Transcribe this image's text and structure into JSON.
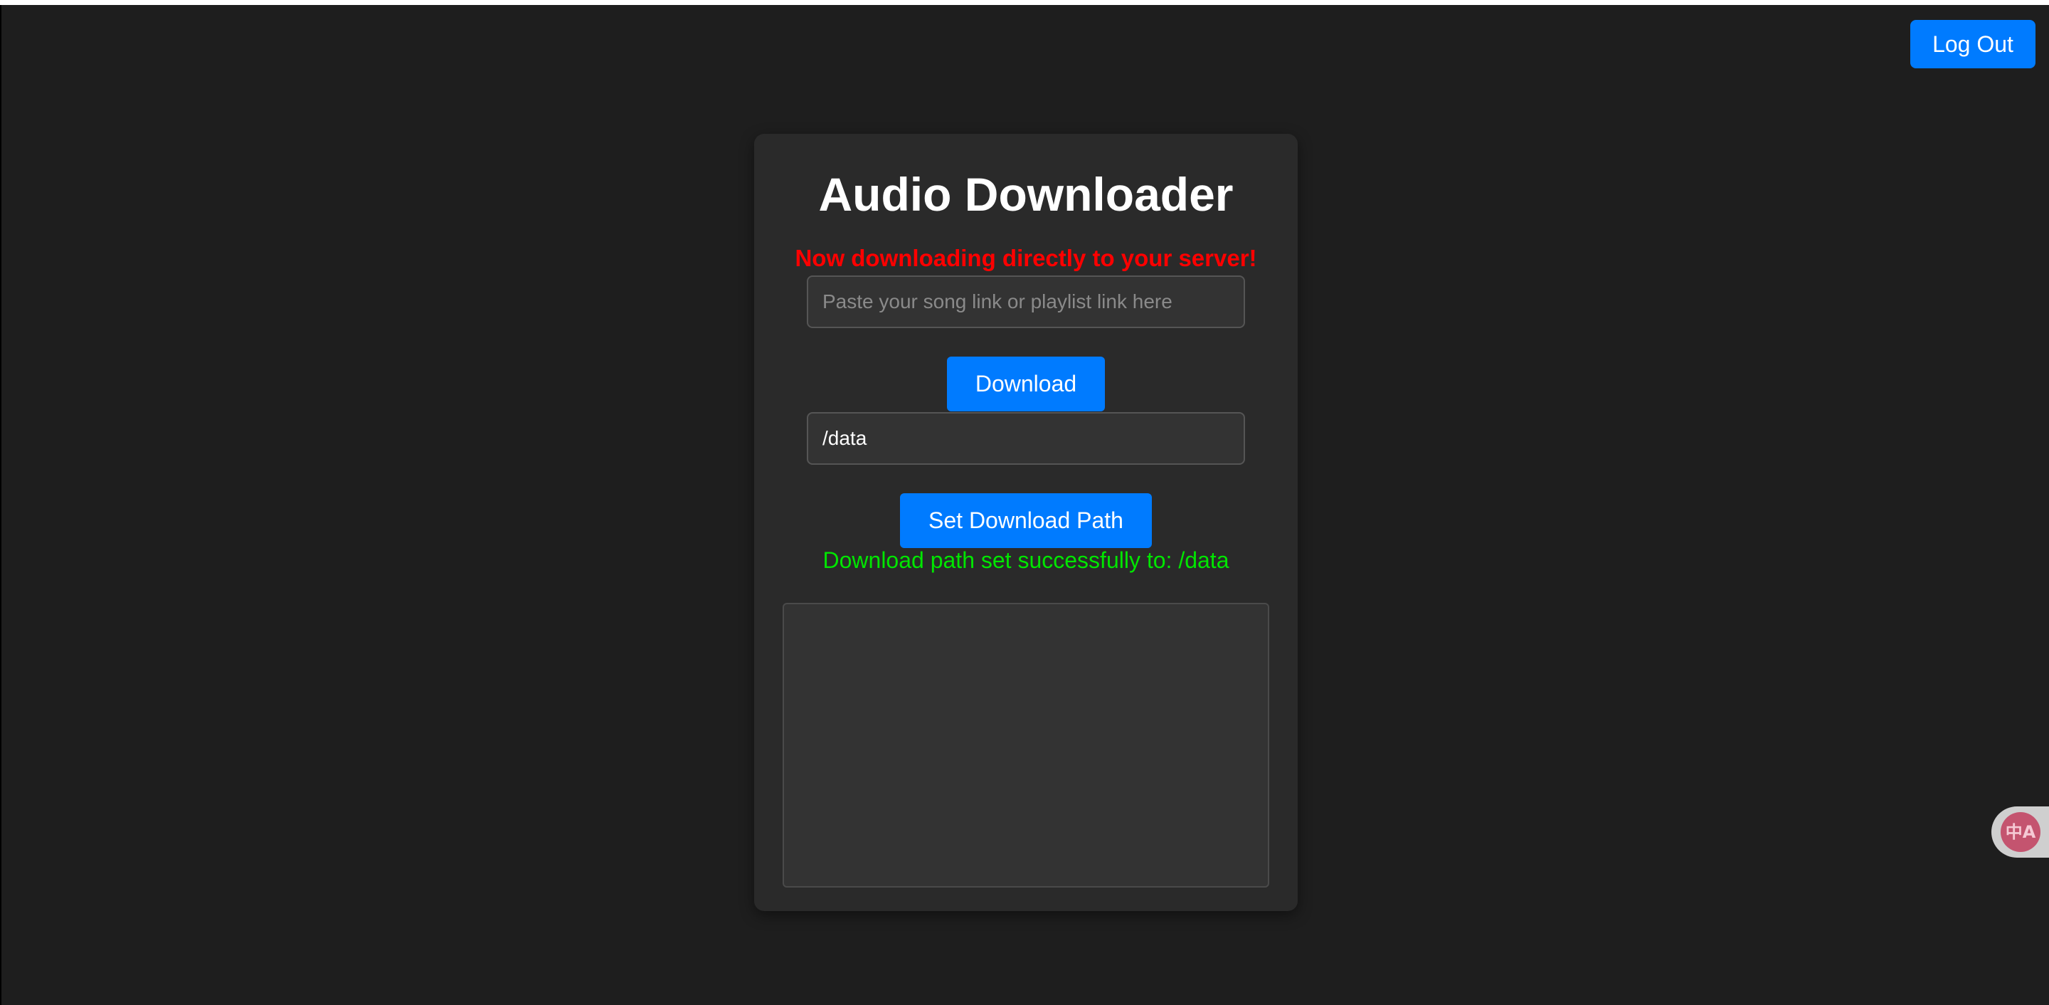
{
  "header": {
    "logout_label": "Log Out"
  },
  "downloader": {
    "title": "Audio Downloader",
    "notice": "Now downloading directly to your server!",
    "url_input": {
      "placeholder": "Paste your song link or playlist link here",
      "value": ""
    },
    "download_label": "Download",
    "path_input": {
      "value": "/data"
    },
    "set_path_label": "Set Download Path",
    "status_message": "Download path set successfully to: /data",
    "log_output": ""
  },
  "translate_widget": {
    "icon": "translate-icon",
    "glyph": "中A"
  },
  "colors": {
    "background": "#1e1e1e",
    "card": "#2a2a2a",
    "accent": "#007bff",
    "notice": "#ff0000",
    "success": "#00e600"
  }
}
